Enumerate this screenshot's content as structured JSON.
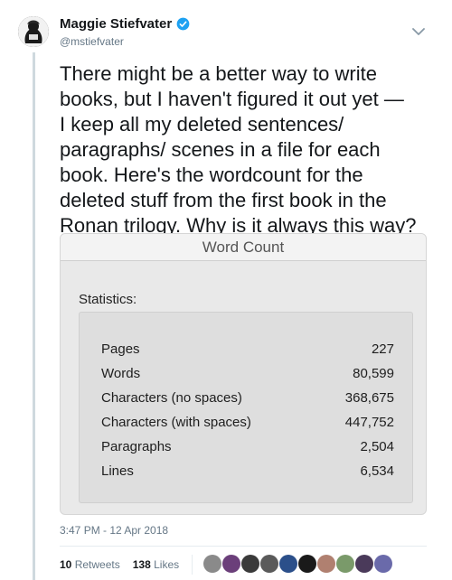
{
  "author": {
    "name": "Maggie Stiefvater",
    "handle": "@mstiefvater"
  },
  "tweet": {
    "text_lines": [
      "There might be a better way to write",
      "books, but I haven't figured it out yet —",
      "I keep all my deleted sentences/",
      "paragraphs/ scenes in a file for each",
      "book. Here's the wordcount for the",
      "deleted stuff from the first book in the",
      "Ronan trilogy. Why is it always this way?"
    ],
    "timestamp": "3:47 PM - 12 Apr 2018"
  },
  "media": {
    "window_title": "Word Count",
    "stats_label": "Statistics:",
    "stats": [
      {
        "label": "Pages",
        "value": "227"
      },
      {
        "label": "Words",
        "value": "80,599"
      },
      {
        "label": "Characters (no spaces)",
        "value": "368,675"
      },
      {
        "label": "Characters (with spaces)",
        "value": "447,752"
      },
      {
        "label": "Paragraphs",
        "value": "2,504"
      },
      {
        "label": "Lines",
        "value": "6,534"
      }
    ]
  },
  "engagement": {
    "retweets_count": "10",
    "retweets_label": "Retweets",
    "likes_count": "138",
    "likes_label": "Likes",
    "liker_colors": [
      "#8a8a8a",
      "#6b3f7a",
      "#3a3a3a",
      "#5a5a5a",
      "#2b4f8a",
      "#1a1a1a",
      "#b08070",
      "#7a9a6a",
      "#4a3a5a",
      "#6a6aaa"
    ]
  },
  "colors": {
    "accent": "#1da1f2",
    "secondary_text": "#657786"
  }
}
